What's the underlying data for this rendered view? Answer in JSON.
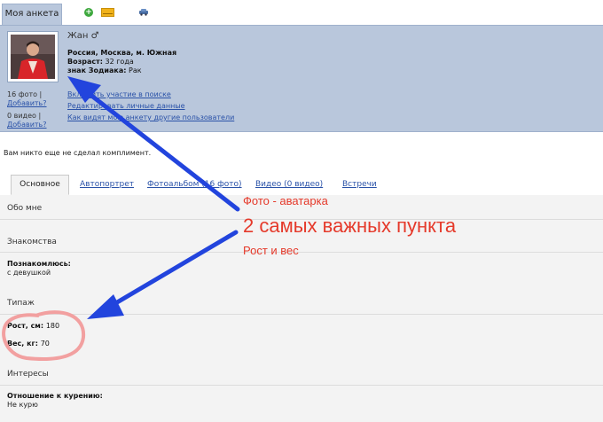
{
  "tabs_top": {
    "active": "Моя анкета"
  },
  "profile": {
    "name": "Жан ♂",
    "location": "Россия, Москва, м. Южная",
    "age_label": "Возраст:",
    "age_value": "32 года",
    "zodiac_label": "знак Зодиака:",
    "zodiac_value": "Рак",
    "photos": "16 фото |",
    "photos_add": "Добавить?",
    "videos": "0 видео |",
    "videos_add": "Добавить?",
    "link1": "Включить участие в поиске",
    "link2": "Редактировать личные данные",
    "link3": "Как видят мою анкету другие пользователи"
  },
  "compliment": "Вам никто еще не сделал комплимент.",
  "tabs": [
    "Основное",
    "Автопортрет",
    "Фотоальбом (16 фото)",
    "Видео (0 видео)",
    "Встречи"
  ],
  "sections": {
    "about": "Обо мне",
    "dating": "Знакомства",
    "dating_label": "Познакомлюсь:",
    "dating_value": "с девушкой",
    "type": "Типаж",
    "height_label": "Рост, см:",
    "height_value": "180",
    "weight_label": "Вес, кг:",
    "weight_value": "70",
    "interests": "Интересы",
    "smoking_label": "Отношение к курению:",
    "smoking_value": "Не курю"
  },
  "annotations": {
    "photo": "Фото - аватарка",
    "main": "2 самых важных пункта",
    "height": "Рост и вес"
  },
  "colors": {
    "panel": "#b9c7dc",
    "link": "#2a52a8",
    "annotation": "#e5392a",
    "arrow": "#2244dd"
  }
}
